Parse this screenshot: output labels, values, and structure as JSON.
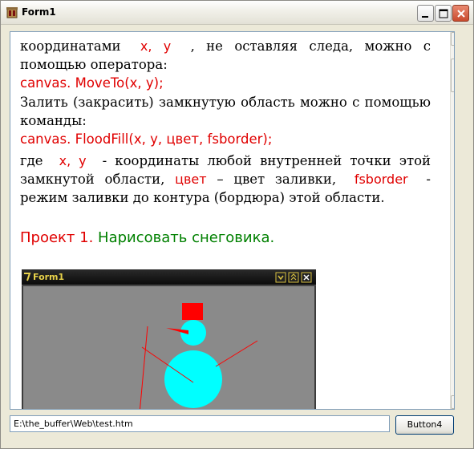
{
  "window": {
    "title": "Form1"
  },
  "article": {
    "para1": {
      "before": "координатами",
      "vars": "x, y",
      "after": ", не оставляя следа, можно с помощью оператора:"
    },
    "code1": "canvas. MoveTo(x, y);",
    "para2": "Залить (закрасить) замкнутую область можно с помощью команды:",
    "code2": "canvas. FloodFill(x, y, цвет, fsborder);",
    "para3": {
      "w1": "где",
      "vars": "x, y",
      "t1": "- координаты любой внутренней точки этой замкнутой области,",
      "color_word": "цвет",
      "t2": "– цвет заливки,",
      "fsborder": "fsborder",
      "t3": "- режим заливки до контура (бордюра) этой области."
    },
    "project": {
      "label": "Проект 1.",
      "title": "Нарисовать снеговика."
    }
  },
  "embedded_screenshot": {
    "title": "Form1",
    "colors": {
      "snowman": "#00ffff",
      "hat": "#ff0000",
      "lines": "#ff0000",
      "background": "#8a8a8a"
    }
  },
  "address_bar": {
    "value": "E:\\the_buffer\\Web\\test.htm"
  },
  "button4": {
    "label": "Button4"
  },
  "icons": {
    "app": "app-icon",
    "minimize": "minimize-icon",
    "maximize": "maximize-icon",
    "close": "close-icon",
    "scroll_up": "scroll-up-arrow-icon",
    "scroll_down": "scroll-down-arrow-icon"
  }
}
